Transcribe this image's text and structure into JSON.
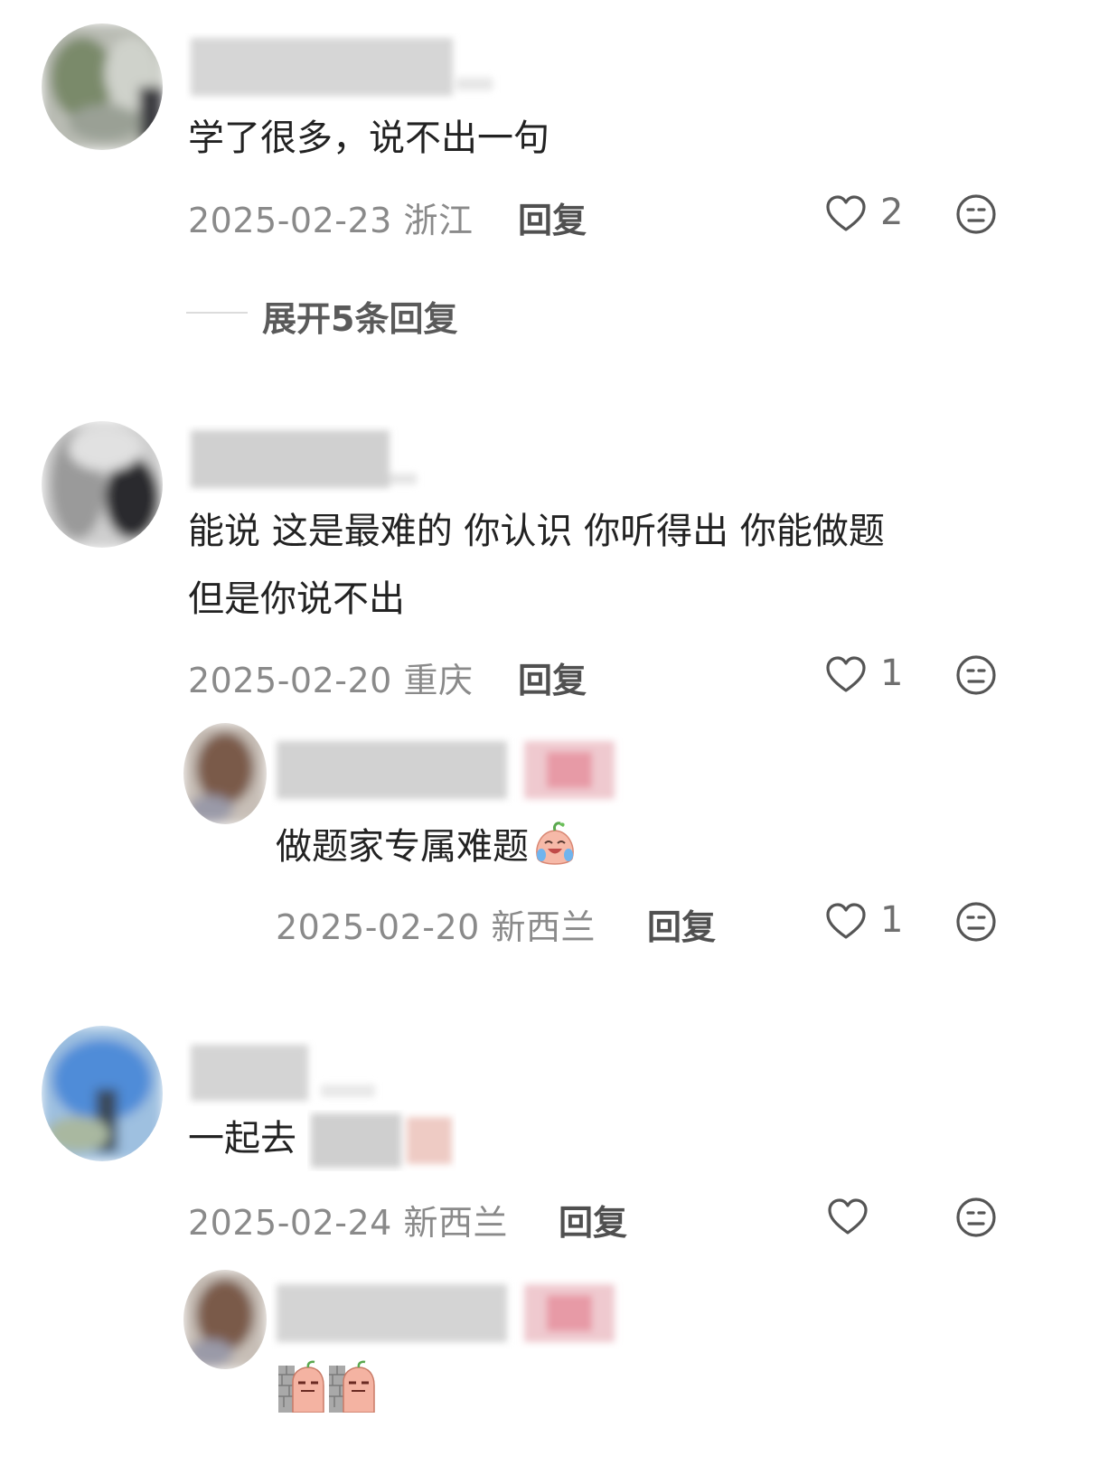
{
  "comments": [
    {
      "text": "学了很多，说不出一句",
      "date": "2025-02-23",
      "location": "浙江",
      "reply_label": "回复",
      "likes": "2",
      "expand_label": "展开5条回复"
    },
    {
      "text_line1": "能说 这是最难的 你认识 你听得出 你能做题",
      "text_line2": "但是你说不出",
      "date": "2025-02-20",
      "location": "重庆",
      "reply_label": "回复",
      "likes": "1",
      "reply": {
        "text": "做题家专属难题",
        "emoji": "crying-laugh-emoji",
        "date": "2025-02-20",
        "location": "新西兰",
        "reply_label": "回复",
        "likes": "1"
      }
    },
    {
      "text": "一起去",
      "date": "2025-02-24",
      "location": "新西兰",
      "reply_label": "回复",
      "likes": "",
      "reply": {
        "emojis": [
          "peeking-emoji",
          "peeking-emoji"
        ]
      }
    }
  ],
  "colors": {
    "text": "#222222",
    "meta": "#8a8a8a",
    "icon": "#555555"
  }
}
